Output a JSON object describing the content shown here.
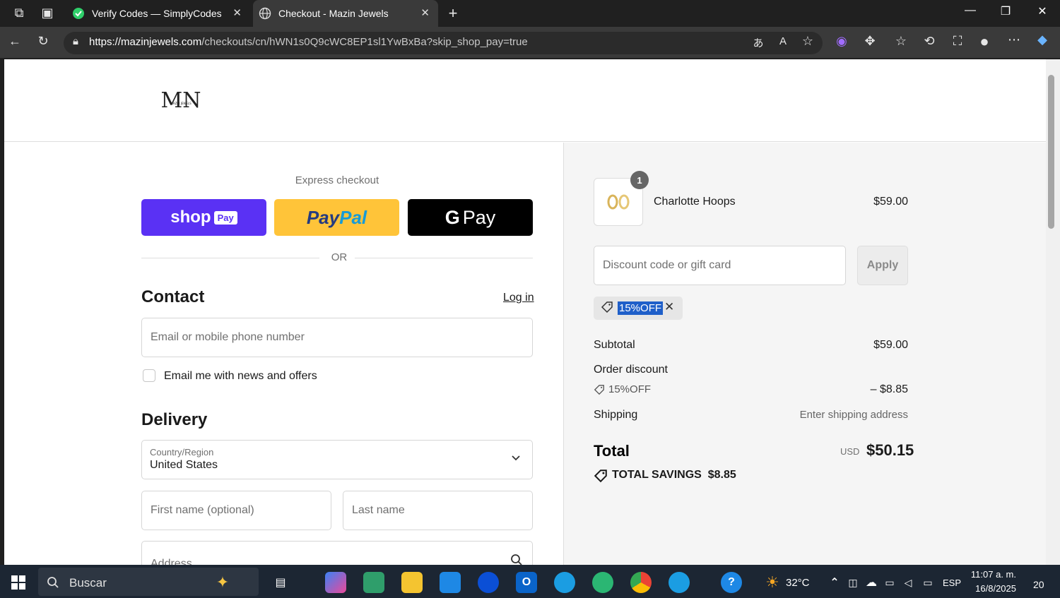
{
  "browser": {
    "tabs": [
      {
        "title": "Verify Codes — SimplyCodes",
        "active": false
      },
      {
        "title": "Checkout - Mazin Jewels",
        "active": true
      }
    ],
    "url_host": "https://mazinjewels.com",
    "url_path": "/checkouts/cn/hWN1s0Q9cWC8EP1sl1YwBxBa?skip_shop_pay=true"
  },
  "store": {
    "logo_text": "MN",
    "logo_subtext": "MAZIN JEWELS"
  },
  "checkout": {
    "express_label": "Express checkout",
    "shop_pay": {
      "text": "shop",
      "badge": "Pay"
    },
    "paypal": {
      "text_a": "Pay",
      "text_b": "Pal"
    },
    "gpay": {
      "g": "G",
      "text": "Pay"
    },
    "or_text": "OR",
    "contact": {
      "heading": "Contact",
      "login_link": "Log in",
      "email_placeholder": "Email or mobile phone number",
      "newsletter_label": "Email me with news and offers"
    },
    "delivery": {
      "heading": "Delivery",
      "country_label": "Country/Region",
      "country_value": "United States",
      "first_name_placeholder": "First name (optional)",
      "last_name_placeholder": "Last name",
      "address_placeholder": "Address"
    }
  },
  "summary": {
    "product": {
      "qty": "1",
      "name": "Charlotte Hoops",
      "price": "$59.00"
    },
    "discount_placeholder": "Discount code or gift card",
    "apply_label": "Apply",
    "applied_code": "15%OFF",
    "subtotal_label": "Subtotal",
    "subtotal_value": "$59.00",
    "order_discount_label": "Order discount",
    "discount_code": "15%OFF",
    "discount_value": "– $8.85",
    "shipping_label": "Shipping",
    "shipping_value": "Enter shipping address",
    "total_label": "Total",
    "total_currency": "USD",
    "total_value": "$50.15",
    "savings_label": "TOTAL SAVINGS",
    "savings_value": "$8.85"
  },
  "taskbar": {
    "search_text": "Buscar",
    "weather": "32°C",
    "language": "ESP",
    "time": "11:07 a. m.",
    "date": "16/8/2025",
    "notifications": "20"
  },
  "colors": {
    "shop_pay": "#5a31f4",
    "paypal": "#ffc439",
    "gpay": "#000000",
    "selection": "#1f5fc9"
  }
}
